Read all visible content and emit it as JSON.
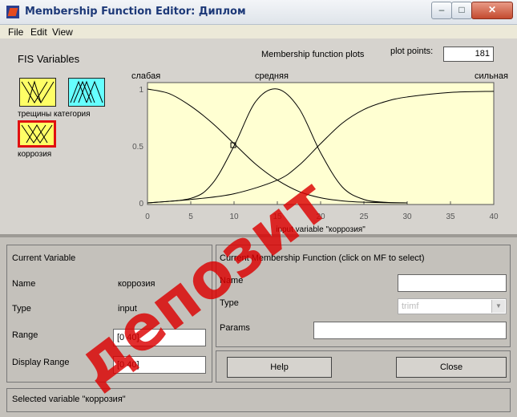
{
  "window": {
    "title": "Membership Function Editor: Диплом",
    "controls": {
      "minimize": "–",
      "maximize": "□",
      "close": "✕"
    }
  },
  "menu": [
    "File",
    "Edit",
    "View"
  ],
  "fis_variables": {
    "heading": "FIS Variables",
    "variables": [
      {
        "label": "трещины",
        "selected": false,
        "color": "#ffff66"
      },
      {
        "label": "категория",
        "selected": false,
        "color": "#66ffff"
      },
      {
        "label": "коррозия",
        "selected": true,
        "color": "#ffff66"
      }
    ]
  },
  "plot": {
    "heading": "Membership function plots",
    "plot_points_label": "plot points:",
    "plot_points_value": "181"
  },
  "chart_data": {
    "type": "line",
    "xlabel": "input variable \"коррозия\"",
    "ylabel": "",
    "xlim": [
      0,
      40
    ],
    "ylim": [
      0,
      1
    ],
    "x_ticks": [
      "0",
      "5",
      "10",
      "15",
      "20",
      "25",
      "30",
      "35",
      "40"
    ],
    "y_ticks": [
      "0",
      "0.5",
      "1"
    ],
    "grid": false,
    "series": [
      {
        "name": "слабая",
        "x": [
          0,
          2.5,
          5,
          7.5,
          10,
          12.5,
          15,
          17.5,
          20,
          22.5,
          25,
          27.5,
          30
        ],
        "y": [
          1.0,
          0.96,
          0.85,
          0.7,
          0.52,
          0.34,
          0.2,
          0.1,
          0.045,
          0.018,
          0.006,
          0.002,
          0.0
        ]
      },
      {
        "name": "средняя",
        "x": [
          0,
          5,
          7.5,
          10,
          12.5,
          15,
          17.5,
          20,
          22.5,
          25,
          27.5,
          30
        ],
        "y": [
          0.0,
          0.04,
          0.17,
          0.5,
          0.89,
          1.0,
          0.83,
          0.44,
          0.14,
          0.03,
          0.005,
          0.0
        ]
      },
      {
        "name": "сильная",
        "x": [
          0,
          5,
          10,
          15,
          17.5,
          20,
          22.5,
          25,
          27.5,
          30,
          35,
          40
        ],
        "y": [
          0.0,
          0.03,
          0.08,
          0.2,
          0.33,
          0.52,
          0.7,
          0.82,
          0.89,
          0.93,
          0.97,
          0.98
        ]
      }
    ],
    "curve_labels": [
      "слабая",
      "средняя",
      "сильная"
    ]
  },
  "current_variable": {
    "heading": "Current Variable",
    "name_label": "Name",
    "name_value": "коррозия",
    "type_label": "Type",
    "type_value": "input",
    "range_label": "Range",
    "range_value": "[0 40]",
    "display_range_label": "Display Range",
    "display_range_value": "[0 40]"
  },
  "current_mf": {
    "heading": "Current Membership Function (click on MF to select)",
    "name_label": "Name",
    "name_value": "",
    "type_label": "Type",
    "type_value": "trimf",
    "params_label": "Params",
    "params_value": ""
  },
  "buttons": {
    "help": "Help",
    "close": "Close"
  },
  "status": "Selected variable \"коррозия\"",
  "watermark": "депозит"
}
